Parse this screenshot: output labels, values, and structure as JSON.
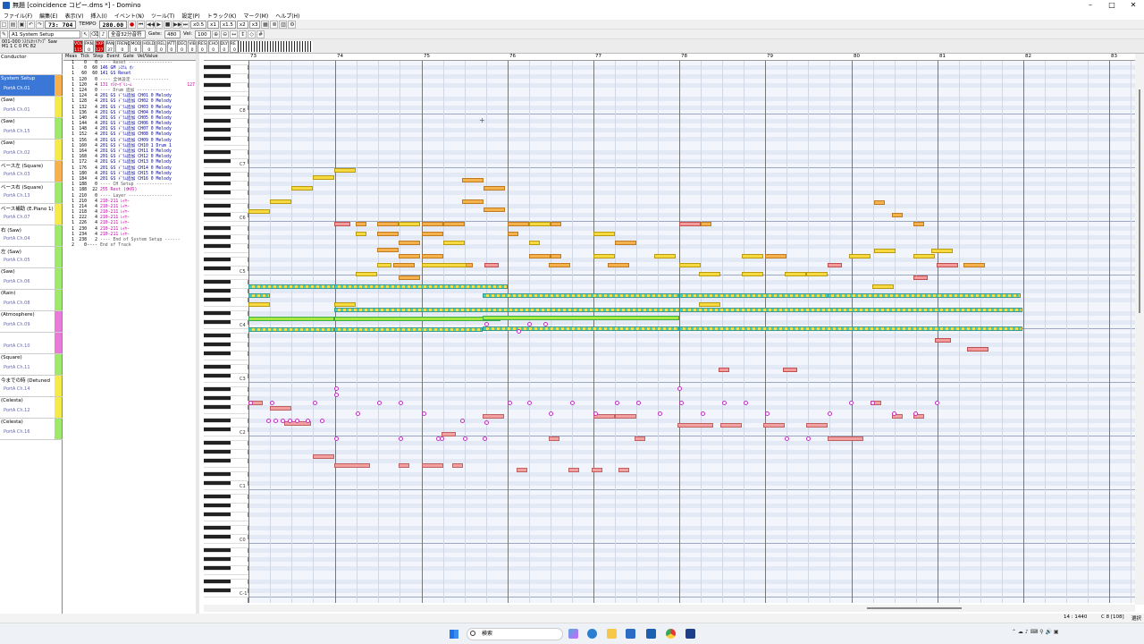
{
  "window": {
    "title": "無題 [coincidence コピー.dms *] - Domino",
    "min": "–",
    "max": "□",
    "close": "✕"
  },
  "menu": [
    "ファイル(F)",
    "編集(E)",
    "表示(V)",
    "挿入(I)",
    "イベント(N)",
    "ツール(T)",
    "設定(P)",
    "トラック(K)",
    "マーク(M)",
    "ヘルプ(H)"
  ],
  "toolbar": {
    "position": "73: 704",
    "tempo_label": "TEMPO",
    "tempo": "280.00",
    "speed": [
      "x0.5",
      "x1",
      "x1.5",
      "x2",
      "x3"
    ],
    "track_select": "A1 System Setup",
    "quantize": "全音32分音符",
    "gate_label": "Gate:",
    "gate": "480",
    "vel_label": "Vel:",
    "vel": "100"
  },
  "track_info": {
    "line1": "001-000 ｼｽﾃﾑｾｯﾄｱｯﾌﾟ Saw",
    "line2": "M1  1  C  0  PC  82"
  },
  "meters": [
    "VOL",
    "PAN",
    "EXP",
    "PAN",
    "FRENQ",
    "MOD",
    "HOLD",
    "REL",
    "ATT",
    "DEC",
    "VIB",
    "RES",
    "CHO",
    "DLY",
    "REV"
  ],
  "meter_values": [
    "115",
    "0",
    "127",
    "37",
    "0",
    "0",
    "0",
    "0",
    "0",
    "0",
    "0",
    "0",
    "0",
    "0",
    "0"
  ],
  "tracks": [
    {
      "name": "Conductor",
      "port": "",
      "color": "#ffffff"
    },
    {
      "name": "System Setup",
      "port": "PortA  Ch.01",
      "color": "#f8b04a"
    },
    {
      "name": "(Saw)",
      "port": "PortA  Ch.01",
      "color": "#f6e94a"
    },
    {
      "name": "(Saw)",
      "port": "PortA  Ch.15",
      "color": "#9ee86a"
    },
    {
      "name": "(Saw)",
      "port": "PortA  Ch.02",
      "color": "#f6e94a"
    },
    {
      "name": "ベース左 (Square)",
      "port": "PortA  Ch.03",
      "color": "#f8b04a"
    },
    {
      "name": "ベース右 (Square)",
      "port": "PortA  Ch.13",
      "color": "#9ee86a"
    },
    {
      "name": "ベース補助 (E.Piano 1)",
      "port": "PortA  Ch.07",
      "color": "#f6e94a"
    },
    {
      "name": "右 (Saw)",
      "port": "PortA  Ch.04",
      "color": "#9ee86a"
    },
    {
      "name": "左 (Saw)",
      "port": "PortA  Ch.05",
      "color": "#9ee86a"
    },
    {
      "name": "(Saw)",
      "port": "PortA  Ch.06",
      "color": "#9ee86a"
    },
    {
      "name": "(Rain)",
      "port": "PortA  Ch.08",
      "color": "#9ee86a"
    },
    {
      "name": "(Atmosphere)",
      "port": "PortA  Ch.09",
      "color": "#e87ad8"
    },
    {
      "name": "",
      "port": "PortA  Ch.10",
      "color": "#e87ad8"
    },
    {
      "name": "(Square)",
      "port": "PortA  Ch.11",
      "color": "#9ee86a"
    },
    {
      "name": "今までの時 (Detuned",
      "port": "PortA  Ch.14",
      "color": "#f6e94a"
    },
    {
      "name": "(Celesta)",
      "port": "PortA  Ch.12",
      "color": "#f6e94a"
    },
    {
      "name": "(Celesta)",
      "port": "PortA  Ch.16",
      "color": "#9ee86a"
    }
  ],
  "list_headers": [
    "Meas",
    "Tick",
    "Step",
    "Event",
    "Gate",
    "Vel/Value"
  ],
  "list_rows": [
    {
      "m": "1",
      "t": "0",
      "s": "0",
      "e": "---- Reset -----------------",
      "v": "",
      "k": "sec"
    },
    {
      "m": "1",
      "t": "0",
      "s": "60",
      "e": "146 GM ｼｽﾃﾑ ｵﾝ",
      "v": "",
      "k": ""
    },
    {
      "m": "1",
      "t": "60",
      "s": "60",
      "e": "141 GS Reset",
      "v": "",
      "k": ""
    },
    {
      "m": "1",
      "t": "120",
      "s": "0",
      "e": "---- 全体設定 --------------",
      "v": "",
      "k": "sec"
    },
    {
      "m": "1",
      "t": "120",
      "s": "4",
      "e": "131 ﾏｽﾀｰﾎﾞﾘｭｰﾑ",
      "v": "127",
      "k": "pink"
    },
    {
      "m": "1",
      "t": "124",
      "s": "0",
      "e": "---- Drum 追加 -------------",
      "v": "",
      "k": "sec"
    },
    {
      "m": "1",
      "t": "124",
      "s": "4",
      "e": "201 GS ﾄﾞﾗﾑ追加 CH01 0  Melody",
      "v": "",
      "k": ""
    },
    {
      "m": "1",
      "t": "128",
      "s": "4",
      "e": "201 GS ﾄﾞﾗﾑ追加 CH02 0  Melody",
      "v": "",
      "k": ""
    },
    {
      "m": "1",
      "t": "132",
      "s": "4",
      "e": "201 GS ﾄﾞﾗﾑ追加 CH03 0  Melody",
      "v": "",
      "k": ""
    },
    {
      "m": "1",
      "t": "136",
      "s": "4",
      "e": "201 GS ﾄﾞﾗﾑ追加 CH04 0  Melody",
      "v": "",
      "k": ""
    },
    {
      "m": "1",
      "t": "140",
      "s": "4",
      "e": "201 GS ﾄﾞﾗﾑ追加 CH05 0  Melody",
      "v": "",
      "k": ""
    },
    {
      "m": "1",
      "t": "144",
      "s": "4",
      "e": "201 GS ﾄﾞﾗﾑ追加 CH06 0  Melody",
      "v": "",
      "k": ""
    },
    {
      "m": "1",
      "t": "148",
      "s": "4",
      "e": "201 GS ﾄﾞﾗﾑ追加 CH07 0  Melody",
      "v": "",
      "k": ""
    },
    {
      "m": "1",
      "t": "152",
      "s": "4",
      "e": "201 GS ﾄﾞﾗﾑ追加 CH08 0  Melody",
      "v": "",
      "k": ""
    },
    {
      "m": "1",
      "t": "156",
      "s": "4",
      "e": "201 GS ﾄﾞﾗﾑ追加 CH09 0  Melody",
      "v": "",
      "k": ""
    },
    {
      "m": "1",
      "t": "160",
      "s": "4",
      "e": "201 GS ﾄﾞﾗﾑ追加 CH10 1  Drum 1",
      "v": "",
      "k": ""
    },
    {
      "m": "1",
      "t": "164",
      "s": "4",
      "e": "201 GS ﾄﾞﾗﾑ追加 CH11 0  Melody",
      "v": "",
      "k": ""
    },
    {
      "m": "1",
      "t": "168",
      "s": "4",
      "e": "201 GS ﾄﾞﾗﾑ追加 CH12 0  Melody",
      "v": "",
      "k": ""
    },
    {
      "m": "1",
      "t": "172",
      "s": "4",
      "e": "201 GS ﾄﾞﾗﾑ追加 CH13 0  Melody",
      "v": "",
      "k": ""
    },
    {
      "m": "1",
      "t": "176",
      "s": "4",
      "e": "201 GS ﾄﾞﾗﾑ追加 CH14 0  Melody",
      "v": "",
      "k": ""
    },
    {
      "m": "1",
      "t": "180",
      "s": "4",
      "e": "201 GS ﾄﾞﾗﾑ追加 CH15 0  Melody",
      "v": "",
      "k": ""
    },
    {
      "m": "1",
      "t": "184",
      "s": "4",
      "e": "201 GS ﾄﾞﾗﾑ追加 CH16 0  Melody",
      "v": "",
      "k": ""
    },
    {
      "m": "1",
      "t": "188",
      "s": "0",
      "e": "---- CH Setup --------------",
      "v": "",
      "k": "sec"
    },
    {
      "m": "1",
      "t": "188",
      "s": "22",
      "e": "255 Rest (休符)",
      "v": "",
      "k": "pink"
    },
    {
      "m": "1",
      "t": "210",
      "s": "0",
      "e": "---- Layer -----------------",
      "v": "",
      "k": "sec"
    },
    {
      "m": "1",
      "t": "210",
      "s": "4",
      "e": "210-211 ﾚｲﾔｰ",
      "v": "",
      "k": "pink"
    },
    {
      "m": "1",
      "t": "214",
      "s": "4",
      "e": "210-211 ﾚｲﾔｰ",
      "v": "",
      "k": "pink"
    },
    {
      "m": "1",
      "t": "218",
      "s": "4",
      "e": "210-211 ﾚｲﾔｰ",
      "v": "",
      "k": "pink"
    },
    {
      "m": "1",
      "t": "222",
      "s": "4",
      "e": "210-211 ﾚｲﾔｰ",
      "v": "",
      "k": "pink"
    },
    {
      "m": "1",
      "t": "226",
      "s": "4",
      "e": "210-211 ﾚｲﾔｰ",
      "v": "",
      "k": "pink"
    },
    {
      "m": "1",
      "t": "230",
      "s": "4",
      "e": "210-211 ﾚｲﾔｰ",
      "v": "",
      "k": "pink"
    },
    {
      "m": "1",
      "t": "234",
      "s": "4",
      "e": "210-211 ﾚｲﾔｰ",
      "v": "",
      "k": "pink"
    },
    {
      "m": "1",
      "t": "238",
      "s": "2",
      "e": "---- End of System Setup ------",
      "v": "",
      "k": "sec"
    },
    {
      "m": "2",
      "t": "0",
      "s": "----",
      "e": "End of Track",
      "v": "",
      "k": "sec"
    }
  ],
  "measures": [
    "73",
    "74",
    "75",
    "76",
    "77",
    "78",
    "79",
    "80",
    "81",
    "82",
    "83"
  ],
  "octaves": [
    "C8",
    "C7",
    "C6",
    "C5",
    "C4",
    "C3",
    "C2",
    "C1",
    "C0",
    "C-1"
  ],
  "status": {
    "pos": "14 : 1440",
    "note": "C 8 [108]",
    "sel": "選択"
  },
  "taskbar": {
    "search": "検索"
  },
  "colors": {
    "accent": "#3a77d6",
    "yellow": "#f7d940",
    "orange": "#f5b24c",
    "red": "#f49a9a",
    "teal": "#3fd0c0",
    "green": "#a8e840",
    "magenta": "#c030c0"
  }
}
